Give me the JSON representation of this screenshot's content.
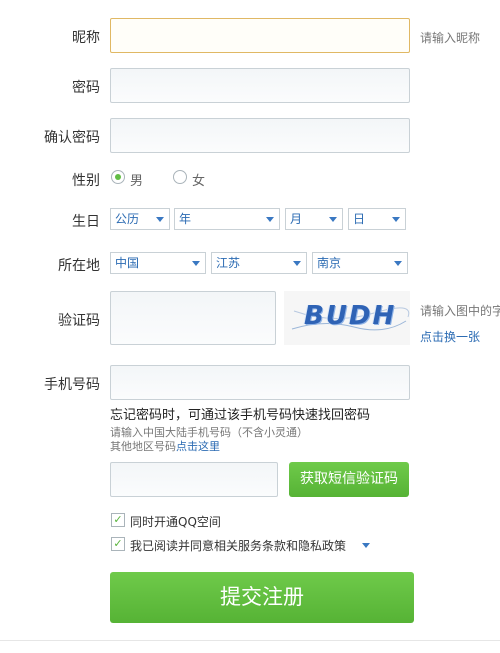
{
  "form": {
    "nickname": {
      "label": "昵称",
      "hint": "请输入昵称",
      "value": ""
    },
    "password": {
      "label": "密码",
      "value": ""
    },
    "confirm": {
      "label": "确认密码",
      "value": ""
    },
    "gender": {
      "label": "性别",
      "options": [
        "男",
        "女"
      ],
      "selected": "男"
    },
    "birthday": {
      "label": "生日",
      "calendar": "公历",
      "year": "年",
      "month": "月",
      "day": "日"
    },
    "location": {
      "label": "所在地",
      "country": "中国",
      "province": "江苏",
      "city": "南京"
    },
    "captcha": {
      "label": "验证码",
      "image_text": "BUDH",
      "hint": "请输入图中的字",
      "refresh": "点击换一张",
      "value": ""
    },
    "phone": {
      "label": "手机号码",
      "value": "",
      "note": "忘记密码时，可通过该手机号码快速找回密码",
      "sub_note": "请输入中国大陆手机号码（不含小灵通）",
      "other_prefix": "其他地区号码",
      "other_link": "点击这里"
    },
    "sms": {
      "value": "",
      "button": "获取短信验证码"
    },
    "qzone": {
      "label": "同时开通QQ空间",
      "checked": true
    },
    "agree": {
      "label": "我已阅读并同意相关服务条款和隐私政策",
      "checked": true
    },
    "submit": "提交注册"
  },
  "colors": {
    "accent_green": "#62bd45",
    "link_blue": "#2b6bb3",
    "focus_border": "#e0b864"
  }
}
